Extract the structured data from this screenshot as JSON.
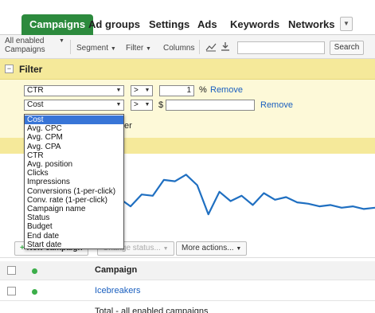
{
  "tabs": [
    {
      "label": "Campaigns"
    },
    {
      "label": "Ad groups"
    },
    {
      "label": "Settings"
    },
    {
      "label": "Ads"
    },
    {
      "label": "Keywords"
    },
    {
      "label": "Networks"
    }
  ],
  "tab_more_icon": "chevron-down-icon",
  "toolbar": {
    "view_line1": "All enabled",
    "view_line2": "Campaigns",
    "segment": "Segment",
    "filter": "Filter",
    "columns": "Columns",
    "search_value": "",
    "search_button": "Search"
  },
  "filter": {
    "title": "Filter",
    "row1": {
      "metric": "CTR",
      "operator": ">",
      "value": "1",
      "unit": "%",
      "remove": "Remove"
    },
    "row2": {
      "metric": "Cost",
      "operator": ">",
      "prefix": "$",
      "value": "",
      "remove": "Remove"
    },
    "partial_text": "er"
  },
  "dropdown_options": [
    "Cost",
    "Avg. CPC",
    "Avg. CPM",
    "Avg. CPA",
    "CTR",
    "Avg. position",
    "Clicks",
    "Impressions",
    "Conversions (1-per-click)",
    "Conv. rate (1-per-click)",
    "Campaign name",
    "Status",
    "Budget",
    "End date",
    "Start date"
  ],
  "dropdown_selected": "Cost",
  "chart_data": {
    "type": "line",
    "title": "",
    "xlabel": "",
    "ylabel": "",
    "series": [
      {
        "values": [
          42,
          30,
          48,
          46,
          70,
          68,
          78,
          62,
          18,
          52,
          38,
          46,
          32,
          50,
          40,
          44,
          36,
          34,
          30,
          32,
          28,
          30,
          26,
          28
        ]
      }
    ],
    "ylim": [
      0,
      100
    ],
    "color": "#1f6fc1"
  },
  "actions": {
    "new_campaign": "New campaign",
    "change_status": "Change status...",
    "more_actions": "More actions..."
  },
  "table": {
    "header": "Campaign",
    "rows": [
      {
        "name": "Icebreakers",
        "status_color": "#3cae4a"
      }
    ],
    "total_label": "Total - all enabled campaigns"
  }
}
